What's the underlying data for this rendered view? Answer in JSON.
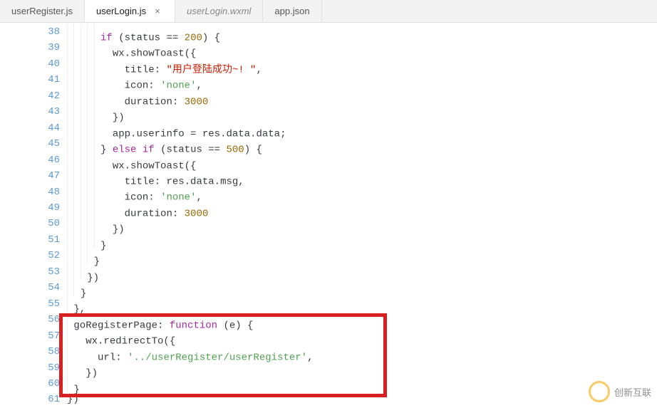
{
  "tabs": [
    {
      "label": "userRegister.js",
      "active": false,
      "closeable": false,
      "italic": false
    },
    {
      "label": "userLogin.js",
      "active": true,
      "closeable": true,
      "italic": false
    },
    {
      "label": "userLogin.wxml",
      "active": false,
      "closeable": false,
      "italic": true
    },
    {
      "label": "app.json",
      "active": false,
      "closeable": false,
      "italic": false
    }
  ],
  "line_start": 38,
  "line_end": 61,
  "code": {
    "l38": {
      "kw": "if",
      "cond_open": " (status == ",
      "num": "200",
      "cond_close": ") {"
    },
    "l39": {
      "text": "wx.showToast({"
    },
    "l40": {
      "key": "title: ",
      "str": "\"用户登陆成功~! \"",
      "tail": ","
    },
    "l41": {
      "key": "icon: ",
      "str": "'none'",
      "tail": ","
    },
    "l42": {
      "key": "duration: ",
      "num": "3000"
    },
    "l43": {
      "text": "})"
    },
    "l44": {
      "text": "app.userinfo = res.data.data;"
    },
    "l45": {
      "close": "} ",
      "kw1": "else",
      "sp": " ",
      "kw2": "if",
      "cond_open": " (status == ",
      "num": "500",
      "cond_close": ") {"
    },
    "l46": {
      "text": "wx.showToast({"
    },
    "l47": {
      "key": "title: ",
      "text": "res.data.msg,",
      "tail": ""
    },
    "l48": {
      "key": "icon: ",
      "str": "'none'",
      "tail": ","
    },
    "l49": {
      "key": "duration: ",
      "num": "3000"
    },
    "l50": {
      "text": "})"
    },
    "l51": {
      "text": "}"
    },
    "l52": {
      "text": "}"
    },
    "l53": {
      "text": "})"
    },
    "l54": {
      "text": "}"
    },
    "l55": {
      "text": "},"
    },
    "l56": {
      "prop": "goRegisterPage: ",
      "kw": "function",
      "args": " (e) {"
    },
    "l57": {
      "text": "wx.redirectTo({"
    },
    "l58": {
      "key": "url: ",
      "str": "'../userRegister/userRegister'",
      "tail": ","
    },
    "l59": {
      "text": "})"
    },
    "l60": {
      "text": "}"
    },
    "l61": {
      "text": "})"
    }
  },
  "watermark": {
    "text": "创新互联"
  }
}
